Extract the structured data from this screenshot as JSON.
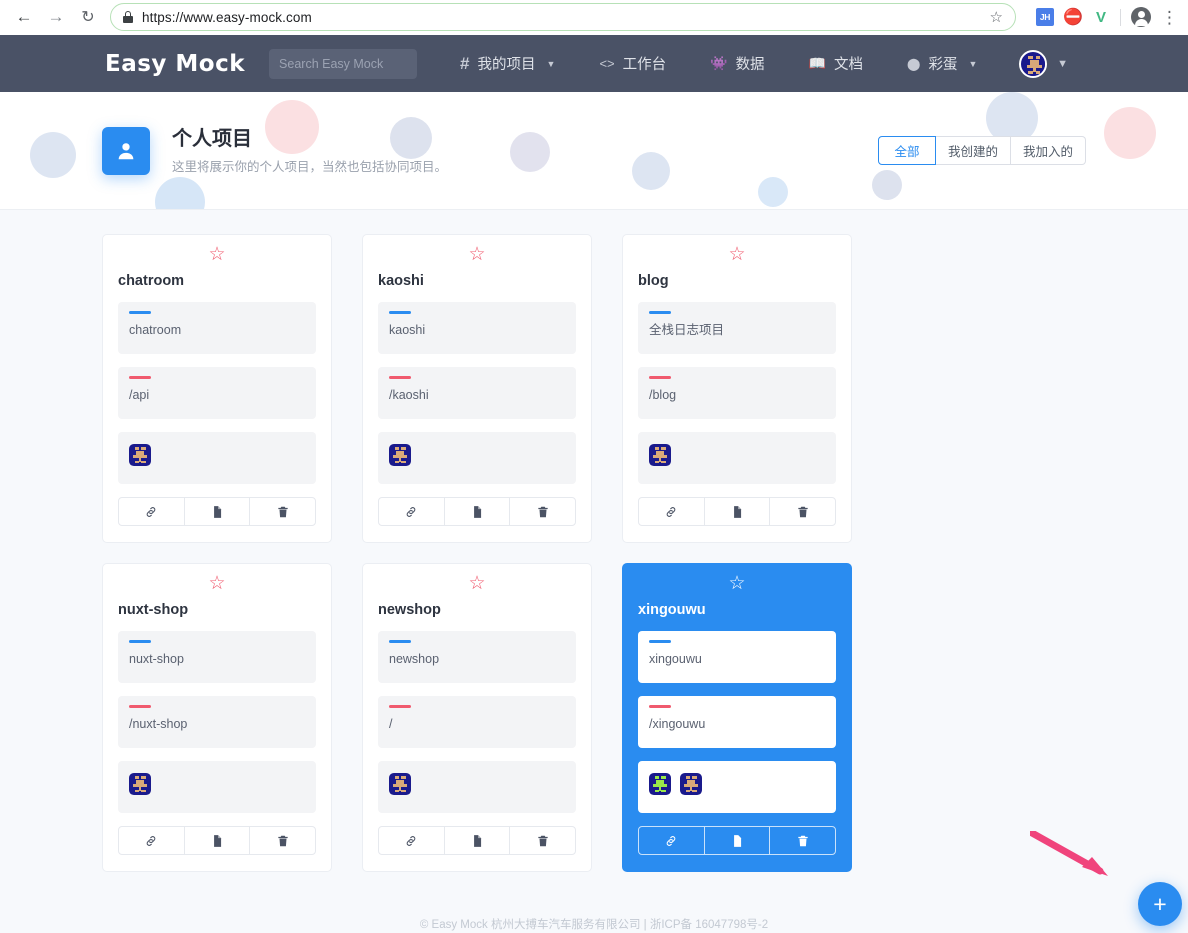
{
  "browser": {
    "url": "https://www.easy-mock.com",
    "back_icon": "back-arrow-icon",
    "forward_icon": "forward-arrow-icon",
    "reload_icon": "reload-icon",
    "bookmark_icon": "star-outline-icon",
    "extensions": [
      {
        "name": "jh-extension-icon",
        "label": "JH"
      },
      {
        "name": "red-circle-extension-icon",
        "label": "⛔"
      },
      {
        "name": "vue-devtools-icon",
        "label": "V"
      }
    ],
    "profile_icon": "profile-avatar-icon",
    "menu_icon": "kebab-menu-icon"
  },
  "navbar": {
    "brand": "Easy Mock",
    "search_placeholder": "Search Easy Mock",
    "search_value": "",
    "links": [
      {
        "name": "my-projects",
        "icon": "hash-icon",
        "glyph": "#",
        "label": "我的项目",
        "caret": true
      },
      {
        "name": "workbench",
        "icon": "code-brackets-icon",
        "glyph": "<>",
        "label": "工作台",
        "caret": false
      },
      {
        "name": "data",
        "icon": "ghost-icon",
        "glyph": "👾",
        "label": "数据",
        "caret": false
      },
      {
        "name": "docs",
        "icon": "book-icon",
        "glyph": "📖",
        "label": "文档",
        "caret": false
      },
      {
        "name": "easter-egg",
        "icon": "egg-icon",
        "glyph": "⬬",
        "label": "彩蛋",
        "caret": true
      }
    ],
    "avatar_name": "user-avatar",
    "avatar_caret": "⌄"
  },
  "header": {
    "icon_name": "person-icon",
    "title": "个人项目",
    "subtitle": "这里将展示你的个人项目，当然也包括协同项目。",
    "filters": [
      {
        "label": "全部",
        "active": true
      },
      {
        "label": "我创建的",
        "active": false
      },
      {
        "label": "我加入的",
        "active": false
      }
    ]
  },
  "cards": [
    {
      "name": "chatroom",
      "title": "chatroom",
      "description": "chatroom",
      "path": "/api",
      "starred": false,
      "selected": false,
      "members": [
        {
          "skin": "tan"
        }
      ]
    },
    {
      "name": "kaoshi",
      "title": "kaoshi",
      "description": "kaoshi",
      "path": "/kaoshi",
      "starred": false,
      "selected": false,
      "members": [
        {
          "skin": "tan"
        }
      ]
    },
    {
      "name": "blog",
      "title": "blog",
      "description": "全栈日志项目",
      "path": "/blog",
      "starred": false,
      "selected": false,
      "members": [
        {
          "skin": "tan"
        }
      ]
    },
    {
      "name": "nuxt-shop",
      "title": "nuxt-shop",
      "description": "nuxt-shop",
      "path": "/nuxt-shop",
      "starred": false,
      "selected": false,
      "members": [
        {
          "skin": "tan"
        }
      ]
    },
    {
      "name": "newshop",
      "title": "newshop",
      "description": "newshop",
      "path": "/",
      "starred": false,
      "selected": false,
      "members": [
        {
          "skin": "tan"
        }
      ]
    },
    {
      "name": "xingouwu",
      "title": "xingouwu",
      "description": "xingouwu",
      "path": "/xingouwu",
      "starred": false,
      "selected": true,
      "members": [
        {
          "skin": "green"
        },
        {
          "skin": "tan"
        }
      ]
    }
  ],
  "card_actions": [
    {
      "name": "copy-link-button",
      "icon": "link-icon"
    },
    {
      "name": "copy-project-button",
      "icon": "document-icon"
    },
    {
      "name": "delete-project-button",
      "icon": "trash-icon"
    }
  ],
  "fab": {
    "name": "create-project-button",
    "label": "+"
  },
  "footer": {
    "text": "© Easy Mock 杭州大搏车汽车服务有限公司 | 浙ICP备 16047798号-2"
  },
  "colors": {
    "accent": "#2a8cf0",
    "navbar": "#4a5266",
    "star": "#f05a6e",
    "arrow": "#f0447c",
    "page_bg": "#f7f9fc"
  },
  "annotation": {
    "arrow_name": "pink-annotation-arrow"
  }
}
